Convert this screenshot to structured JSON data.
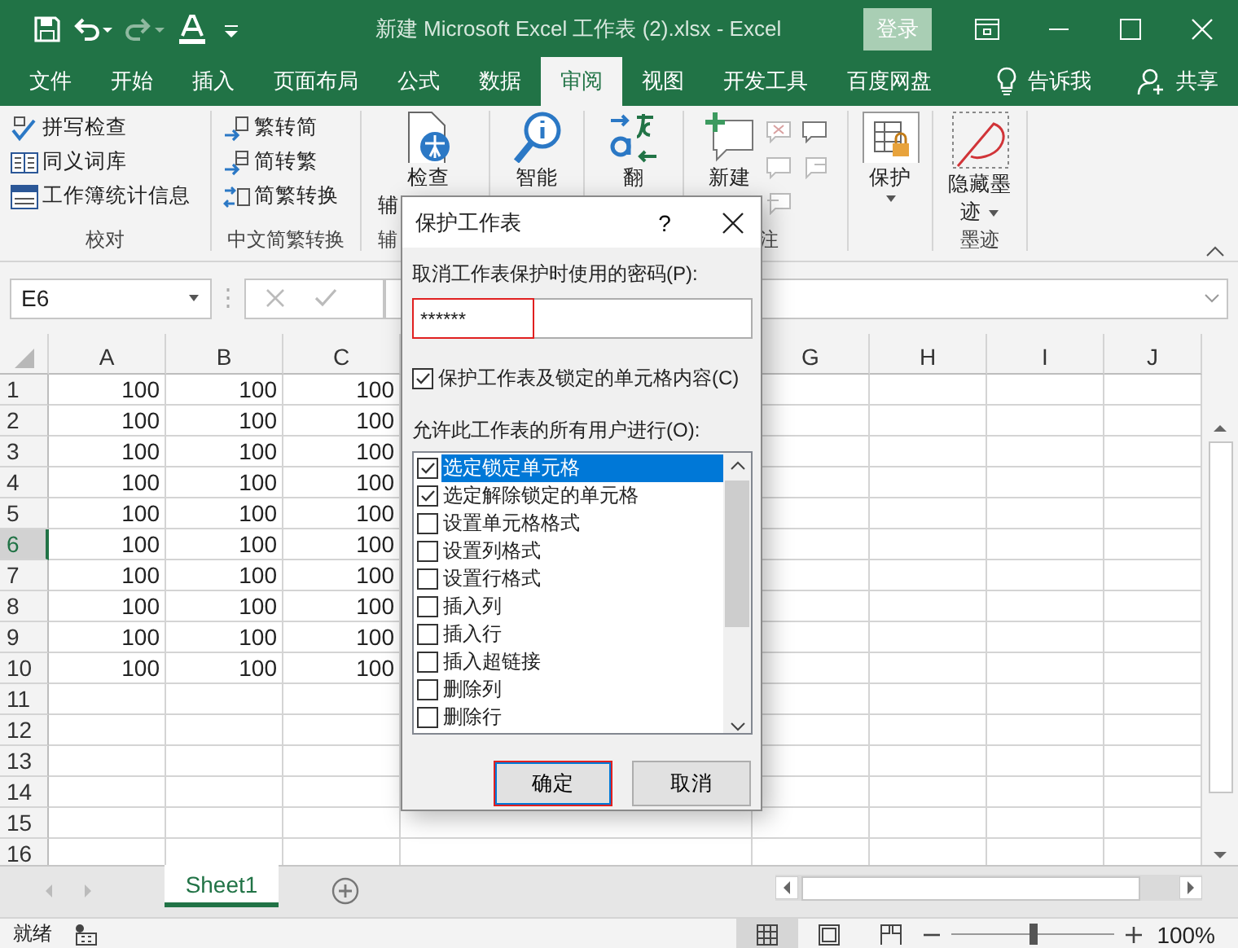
{
  "title_bar": {
    "title": "新建 Microsoft Excel 工作表 (2).xlsx  -  Excel",
    "sign_in": "登录",
    "redo": {
      "disabled": true
    }
  },
  "tabs": [
    {
      "label": "文件",
      "selected": false
    },
    {
      "label": "开始",
      "selected": false
    },
    {
      "label": "插入",
      "selected": false
    },
    {
      "label": "页面布局",
      "selected": false
    },
    {
      "label": "公式",
      "selected": false
    },
    {
      "label": "数据",
      "selected": false
    },
    {
      "label": "审阅",
      "selected": true
    },
    {
      "label": "视图",
      "selected": false
    },
    {
      "label": "开发工具",
      "selected": false
    },
    {
      "label": "百度网盘",
      "selected": false
    }
  ],
  "tell_me": "告诉我",
  "share": "共享",
  "ribbon": {
    "groups": [
      {
        "kind": "list",
        "label": "校对",
        "items": [
          "拼写检查",
          "同义词库",
          "工作簿统计信息"
        ]
      },
      {
        "kind": "list",
        "label": "中文简繁转换",
        "items": [
          "繁转简",
          "简转繁",
          "简繁转换"
        ]
      },
      {
        "kind": "large",
        "label": "辅",
        "lines": [
          "检查",
          "辅"
        ]
      },
      {
        "kind": "large",
        "lines": [
          "智能"
        ]
      },
      {
        "kind": "large",
        "lines": [
          "翻"
        ]
      },
      {
        "kind": "comments",
        "label": "注",
        "lines": [
          "新建"
        ]
      },
      {
        "kind": "menu",
        "lines": [
          "保护"
        ]
      },
      {
        "kind": "menu",
        "label": "墨迹",
        "lines": [
          "隐藏墨",
          "迹"
        ]
      }
    ]
  },
  "formula_bar": {
    "name_box": "E6",
    "buttons_disabled": true
  },
  "sheet": {
    "columns": [
      "A",
      "B",
      "C",
      "G",
      "H",
      "I",
      "J"
    ],
    "rows": [
      {
        "number": "1",
        "selected": false,
        "cells": [
          "100",
          "100",
          "100"
        ]
      },
      {
        "number": "2",
        "selected": false,
        "cells": [
          "100",
          "100",
          "100"
        ]
      },
      {
        "number": "3",
        "selected": false,
        "cells": [
          "100",
          "100",
          "100"
        ]
      },
      {
        "number": "4",
        "selected": false,
        "cells": [
          "100",
          "100",
          "100"
        ]
      },
      {
        "number": "5",
        "selected": false,
        "cells": [
          "100",
          "100",
          "100"
        ]
      },
      {
        "number": "6",
        "selected": true,
        "cells": [
          "100",
          "100",
          "100"
        ]
      },
      {
        "number": "7",
        "selected": false,
        "cells": [
          "100",
          "100",
          "100"
        ]
      },
      {
        "number": "8",
        "selected": false,
        "cells": [
          "100",
          "100",
          "100"
        ]
      },
      {
        "number": "9",
        "selected": false,
        "cells": [
          "100",
          "100",
          "100"
        ]
      },
      {
        "number": "10",
        "selected": false,
        "cells": [
          "100",
          "100",
          "100"
        ]
      },
      {
        "number": "11",
        "selected": false,
        "cells": []
      },
      {
        "number": "12",
        "selected": false,
        "cells": []
      },
      {
        "number": "13",
        "selected": false,
        "cells": []
      },
      {
        "number": "14",
        "selected": false,
        "cells": []
      },
      {
        "number": "15",
        "selected": false,
        "cells": []
      },
      {
        "number": "16",
        "selected": false,
        "cells": []
      }
    ],
    "tabs": [
      {
        "label": "Sheet1",
        "selected": true
      }
    ]
  },
  "status_bar": {
    "text": "就绪",
    "views": [
      {
        "selected": true
      },
      {
        "selected": false
      },
      {
        "selected": false
      }
    ],
    "zoom": {
      "level": 0.5,
      "reading": "100%"
    }
  },
  "dialog": {
    "title": "保护工作表",
    "help": "?",
    "password": {
      "label": "取消工作表保护时使用的密码(P):",
      "value": "******",
      "highlighted": true
    },
    "protect": {
      "label": "保护工作表及锁定的单元格内容(C)",
      "checked": true
    },
    "allow_label": "允许此工作表的所有用户进行(O):",
    "permissions": [
      {
        "label": "选定锁定单元格",
        "checked": true,
        "selected": true
      },
      {
        "label": "选定解除锁定的单元格",
        "checked": true,
        "selected": false
      },
      {
        "label": "设置单元格格式",
        "checked": false,
        "selected": false
      },
      {
        "label": "设置列格式",
        "checked": false,
        "selected": false
      },
      {
        "label": "设置行格式",
        "checked": false,
        "selected": false
      },
      {
        "label": "插入列",
        "checked": false,
        "selected": false
      },
      {
        "label": "插入行",
        "checked": false,
        "selected": false
      },
      {
        "label": "插入超链接",
        "checked": false,
        "selected": false
      },
      {
        "label": "删除列",
        "checked": false,
        "selected": false
      },
      {
        "label": "删除行",
        "checked": false,
        "selected": false
      }
    ],
    "buttons": [
      {
        "label": "确定",
        "default": true,
        "highlighted": true
      },
      {
        "label": "取消",
        "default": false,
        "highlighted": false
      }
    ]
  }
}
